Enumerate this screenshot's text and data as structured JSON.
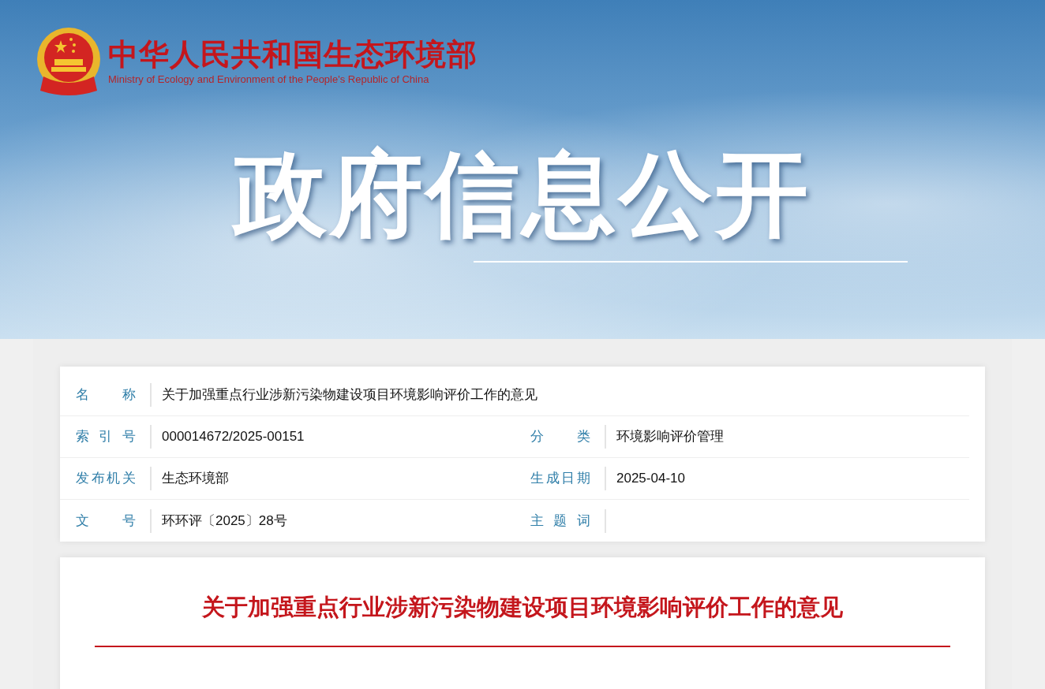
{
  "header": {
    "name_cn": "中华人民共和国生态环境部",
    "name_en": "Ministry of Ecology and Environment of the People's Republic of China",
    "banner_title": "政府信息公开"
  },
  "info": {
    "rows": [
      [
        {
          "label": "名　　称",
          "value": "关于加强重点行业涉新污染物建设项目环境影响评价工作的意见"
        }
      ],
      [
        {
          "label": "索 引 号",
          "value": "000014672/2025-00151"
        },
        {
          "label": "分　　类",
          "value": "环境影响评价管理"
        }
      ],
      [
        {
          "label": "发布机关",
          "value": "生态环境部"
        },
        {
          "label": "生成日期",
          "value": "2025-04-10"
        }
      ],
      [
        {
          "label": "文　　号",
          "value": "环环评〔2025〕28号"
        },
        {
          "label": "主 题 词"
        }
      ]
    ]
  },
  "article": {
    "title": "关于加强重点行业涉新污染物建设项目环境影响评价工作的意见"
  }
}
